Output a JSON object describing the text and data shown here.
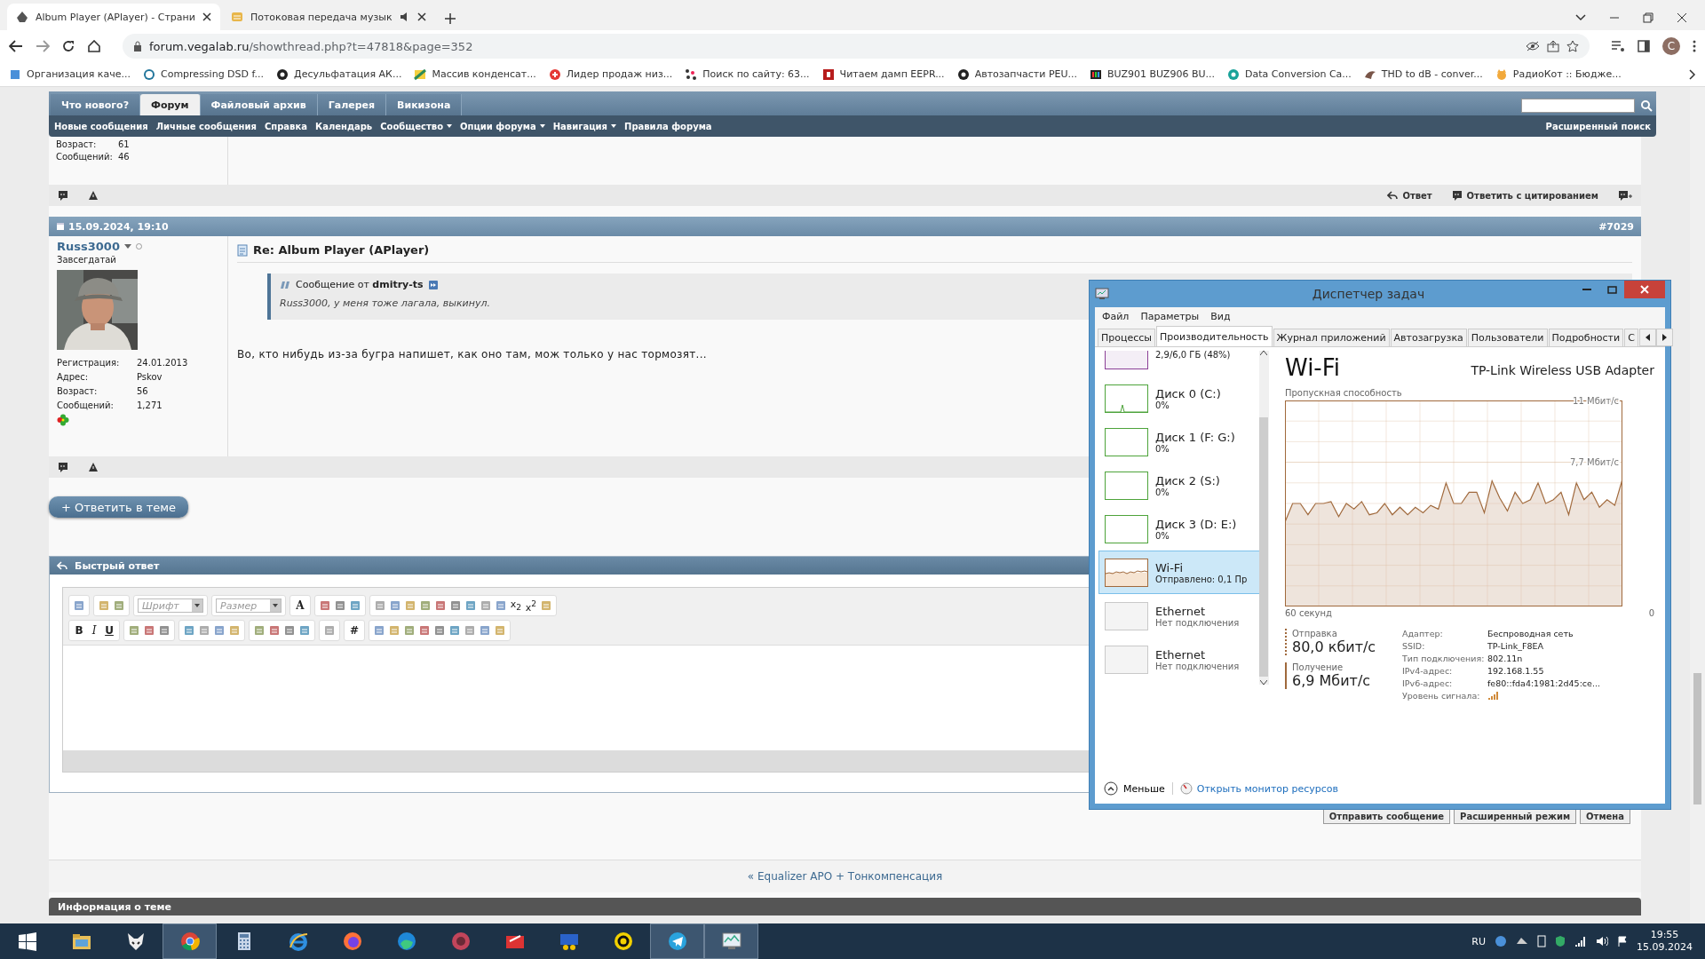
{
  "browser": {
    "tabs": [
      {
        "title": "Album Player (APlayer) - Страни",
        "selected": true,
        "audio": false
      },
      {
        "title": "Потоковая передача музык",
        "selected": false,
        "audio": true
      }
    ],
    "url_host": "forum.vegalab.ru",
    "url_path": "/showthread.php?t=47818&page=352",
    "profile_initial": "C",
    "bookmarks": [
      {
        "title": "Организация каче...",
        "kind": "puzzle"
      },
      {
        "title": "Compressing DSD f...",
        "kind": "wp"
      },
      {
        "title": "Десульфатация АК...",
        "kind": "ball"
      },
      {
        "title": "Массив конденсат...",
        "kind": "flag"
      },
      {
        "title": "Лидер продаж низ...",
        "kind": "red"
      },
      {
        "title": "Поиск по сайту: 63...",
        "kind": "dots"
      },
      {
        "title": "Читаем дамп EEPR...",
        "kind": "square"
      },
      {
        "title": "Автозапчасти PEU...",
        "kind": "ball"
      },
      {
        "title": "BUZ901 BUZ906 BU...",
        "kind": "bars"
      },
      {
        "title": "Data Conversion Ca...",
        "kind": "teal"
      },
      {
        "title": "THD to dB - conver...",
        "kind": "bird"
      },
      {
        "title": "РадиоКот :: Бюдже...",
        "kind": "cat"
      }
    ]
  },
  "forum": {
    "nav_tabs": [
      {
        "label": "Что нового?",
        "selected": false
      },
      {
        "label": "Форум",
        "selected": true
      },
      {
        "label": "Файловый архив",
        "selected": false
      },
      {
        "label": "Галерея",
        "selected": false
      },
      {
        "label": "Викизона",
        "selected": false
      }
    ],
    "subnav": [
      {
        "label": "Новые сообщения",
        "dropdown": false
      },
      {
        "label": "Личные сообщения",
        "dropdown": false
      },
      {
        "label": "Справка",
        "dropdown": false
      },
      {
        "label": "Календарь",
        "dropdown": false
      },
      {
        "label": "Сообщество",
        "dropdown": true
      },
      {
        "label": "Опции форума",
        "dropdown": true
      },
      {
        "label": "Навигация",
        "dropdown": true
      },
      {
        "label": "Правила форума",
        "dropdown": false
      }
    ],
    "advanced_search": "Расширенный поиск",
    "previous_post": {
      "stats": [
        {
          "label": "Возраст:",
          "value": "61"
        },
        {
          "label": "Сообщений:",
          "value": "46"
        }
      ],
      "reply": "Ответ",
      "reply_quote": "Ответить с цитированием"
    },
    "post": {
      "date": "15.09.2024, 19:10",
      "number": "#7029",
      "author": "Russ3000",
      "rank": "Завсегдатай",
      "stats": [
        {
          "label": "Регистрация:",
          "value": "24.01.2013"
        },
        {
          "label": "Адрес:",
          "value": "Pskov"
        },
        {
          "label": "Возраст:",
          "value": "56"
        },
        {
          "label": "Сообщений:",
          "value": "1,271"
        }
      ],
      "title": "Re: Album Player (APlayer)",
      "quote": {
        "header": "Сообщение от **dmitry-ts**",
        "text": "Russ3000, у меня тоже лагала, выкинул."
      },
      "text": "Во, кто нибудь из-за бугра напишет, как оно там, мож только у нас тормозят..."
    },
    "reply_button": "+ Ответить в теме",
    "quick_reply": {
      "title": "Быстрый ответ",
      "toolbar_rows": [
        [
          [
            {
              "kind": "icon"
            }
          ],
          [
            {
              "kind": "icon"
            },
            {
              "kind": "icon"
            }
          ],
          [
            {
              "kind": "select",
              "placeholder": "Шрифт"
            }
          ],
          [
            {
              "kind": "select",
              "placeholder": "Размер"
            }
          ],
          [
            {
              "kind": "letter",
              "label": "A"
            }
          ],
          [
            {
              "kind": "icon"
            },
            {
              "kind": "icon"
            },
            {
              "kind": "icon"
            }
          ],
          [
            {
              "kind": "icon"
            },
            {
              "kind": "icon"
            },
            {
              "kind": "icon"
            },
            {
              "kind": "icon"
            },
            {
              "kind": "icon"
            },
            {
              "kind": "icon"
            },
            {
              "kind": "icon"
            },
            {
              "kind": "icon"
            },
            {
              "kind": "icon"
            },
            {
              "kind": "script",
              "label": "x$_{2}$"
            },
            {
              "kind": "script",
              "label": "x$^{2}$"
            },
            {
              "kind": "icon"
            }
          ]
        ],
        [
          [
            {
              "kind": "bold",
              "label": "B"
            },
            {
              "kind": "italic",
              "label": "I"
            },
            {
              "kind": "underline",
              "label": "U"
            }
          ],
          [
            {
              "kind": "icon"
            },
            {
              "kind": "icon"
            },
            {
              "kind": "icon"
            }
          ],
          [
            {
              "kind": "icon"
            },
            {
              "kind": "icon"
            },
            {
              "kind": "icon"
            },
            {
              "kind": "icon"
            }
          ],
          [
            {
              "kind": "icon"
            },
            {
              "kind": "icon"
            },
            {
              "kind": "icon"
            },
            {
              "kind": "icon"
            }
          ],
          [
            {
              "kind": "icon"
            }
          ],
          [
            {
              "kind": "bold",
              "label": "#"
            }
          ],
          [
            {
              "kind": "icon"
            },
            {
              "kind": "icon"
            },
            {
              "kind": "icon"
            },
            {
              "kind": "icon"
            },
            {
              "kind": "icon"
            },
            {
              "kind": "icon"
            },
            {
              "kind": "icon"
            },
            {
              "kind": "icon"
            },
            {
              "kind": "icon"
            }
          ]
        ]
      ],
      "buttons": [
        "Отправить сообщение",
        "Расширенный режим",
        "Отмена"
      ]
    },
    "thread_nav": "« Equalizer APO + Тонкомпенсация",
    "thread_info": "Информация о теме"
  },
  "task_manager": {
    "title": "Диспетчер задач",
    "menu": [
      "Файл",
      "Параметры",
      "Вид"
    ],
    "tabs": [
      {
        "label": "Процессы",
        "selected": false
      },
      {
        "label": "Производительность",
        "selected": true
      },
      {
        "label": "Журнал приложений",
        "selected": false
      },
      {
        "label": "Автозагрузка",
        "selected": false
      },
      {
        "label": "Пользователи",
        "selected": false
      },
      {
        "label": "Подробности",
        "selected": false
      },
      {
        "label": "С",
        "selected": false
      }
    ],
    "resources": [
      {
        "kind": "memory",
        "detail": "2,9/6,0 ГБ (48%)",
        "selected": false
      },
      {
        "kind": "disk",
        "name": "Диск 0 (C:)",
        "detail": "0%",
        "selected": false
      },
      {
        "kind": "disk",
        "name": "Диск 1 (F: G:)",
        "detail": "0%",
        "selected": false
      },
      {
        "kind": "disk",
        "name": "Диск 2 (S:)",
        "detail": "0%",
        "selected": false
      },
      {
        "kind": "disk",
        "name": "Диск 3 (D: E:)",
        "detail": "0%",
        "selected": false
      },
      {
        "kind": "network",
        "name": "Wi-Fi",
        "detail": "Отправлено: 0,1 Пр",
        "selected": true
      },
      {
        "kind": "offline",
        "name": "Ethernet",
        "detail": "Нет подключения",
        "selected": false
      },
      {
        "kind": "offline",
        "name": "Ethernet",
        "detail": "Нет подключения",
        "selected": false
      }
    ],
    "heading": "Wi-Fi",
    "adapter_name": "TP-Link Wireless USB Adapter",
    "time_span_label": "60 секунд",
    "time_end_label": "0",
    "chart_data": {
      "type": "area",
      "title": "Пропускная способность",
      "grid": true,
      "ylim": [
        0,
        11
      ],
      "yticks": [
        {
          "value": 11,
          "label": "11 Мбит/с"
        },
        {
          "value": 7.7,
          "label": "7,7 Мбит/с"
        }
      ],
      "series": [
        {
          "color": "#a0693c",
          "values": [
            4.5,
            5.5,
            5.5,
            4.9,
            5.5,
            5.5,
            5.6,
            4.8,
            5.5,
            5.2,
            5.6,
            4.9,
            5.0,
            5.5,
            4.9,
            5.3,
            4.9,
            5.3,
            5.0,
            5.4,
            5.2,
            6.6,
            5.5,
            5.5,
            6.1,
            6.1,
            5.0,
            6.7,
            5.8,
            5.1,
            6.1,
            5.5,
            5.7,
            6.6,
            5.5,
            5.7,
            6.1,
            4.9,
            6.6,
            5.7,
            6.1,
            5.3,
            5.7,
            5.4,
            6.8
          ]
        }
      ]
    },
    "rates": [
      {
        "label": "Отправка",
        "value": "80,0 кбит/с",
        "kind": "send"
      },
      {
        "label": "Получение",
        "value": "6,9 Мбит/с",
        "kind": "receive"
      }
    ],
    "properties": [
      {
        "label": "Адаптер:",
        "value": "Беспроводная сеть"
      },
      {
        "label": "SSID:",
        "value": "TP-Link_F8EA"
      },
      {
        "label": "Тип подключения:",
        "value": "802.11n"
      },
      {
        "label": "IPv4-адрес:",
        "value": "192.168.1.55"
      },
      {
        "label": "IPv6-адрес:",
        "value": "fe80::fda4:1981:2d45:ce..."
      },
      {
        "label": "Уровень сигнала:",
        "kind": "signal"
      }
    ],
    "fewer": "Меньше",
    "open_monitor": "Открыть монитор ресурсов"
  },
  "taskbar": {
    "items": [
      {
        "kind": "start",
        "active": false
      },
      {
        "kind": "folder",
        "active": false
      },
      {
        "kind": "fox",
        "active": false
      },
      {
        "kind": "chrome",
        "active": true
      },
      {
        "kind": "calculator",
        "active": false
      },
      {
        "kind": "ie",
        "active": false
      },
      {
        "kind": "firefox",
        "active": false
      },
      {
        "kind": "edge",
        "active": false
      },
      {
        "kind": "disc",
        "active": false
      },
      {
        "kind": "toolbox",
        "active": false
      },
      {
        "kind": "player",
        "active": false
      },
      {
        "kind": "ring",
        "active": false
      },
      {
        "kind": "telegram",
        "active": true
      },
      {
        "kind": "monitor",
        "active": true
      }
    ],
    "language": "RU",
    "time": "19:55",
    "date": "15.09.2024"
  }
}
